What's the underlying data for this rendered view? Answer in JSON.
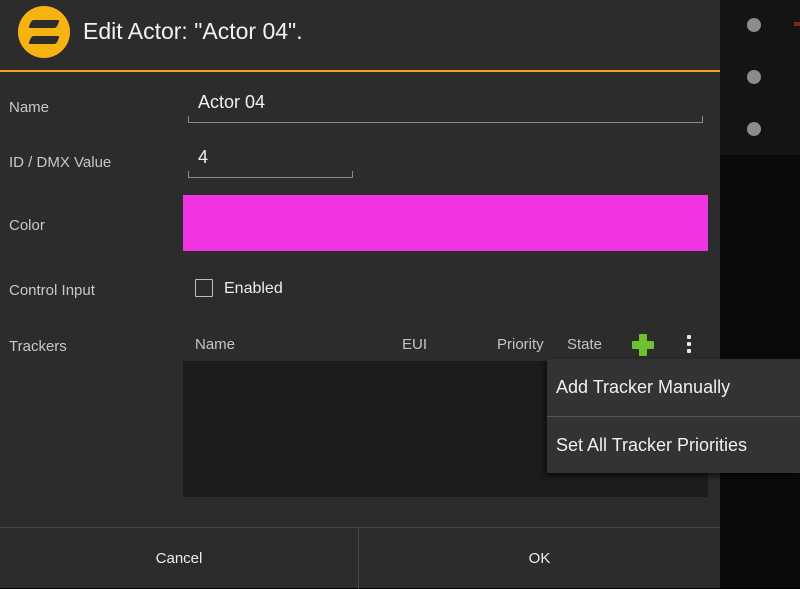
{
  "dialog": {
    "title": "Edit Actor: \"Actor 04\"."
  },
  "form": {
    "name_label": "Name",
    "name_value": "Actor 04",
    "id_label": "ID / DMX Value",
    "id_value": "4",
    "color_label": "Color",
    "color_value": "#f034e4",
    "control_label": "Control Input",
    "control_checkbox_label": "Enabled",
    "control_enabled": false,
    "trackers_label": "Trackers"
  },
  "trackers": {
    "columns": [
      "Name",
      "EUI",
      "Priority",
      "State"
    ],
    "rows": [],
    "add_icon": "plus-icon",
    "more_icon": "more-vertical-icon"
  },
  "menu": {
    "items": [
      "Add Tracker Manually",
      "Set All Tracker Priorities"
    ]
  },
  "buttons": {
    "cancel": "Cancel",
    "ok": "OK"
  },
  "colors": {
    "accent": "#f0a020",
    "logo": "#f6b311",
    "add_icon": "#6ec22d"
  }
}
